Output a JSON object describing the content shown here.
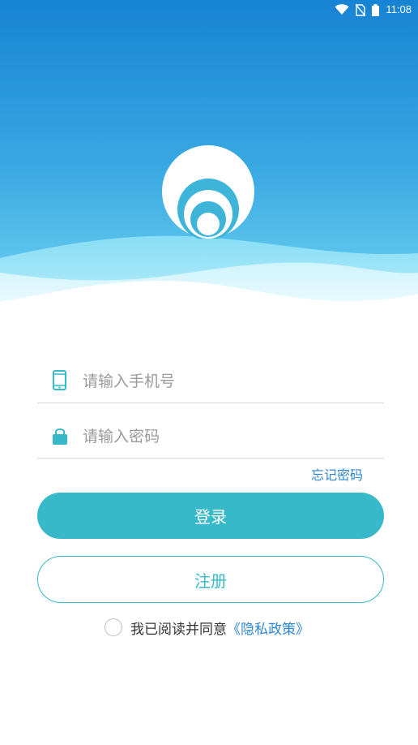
{
  "status_bar": {
    "time": "11:08",
    "icons": [
      "wifi-icon",
      "no-sim-icon",
      "battery-icon"
    ]
  },
  "logo": {
    "icon": "concentric-circles-logo-icon"
  },
  "form": {
    "phone_placeholder": "请输入手机号",
    "phone_icon": "phone-icon",
    "password_placeholder": "请输入密码",
    "password_icon": "lock-icon",
    "forgot_password": "忘记密码",
    "login_label": "登录",
    "register_label": "注册"
  },
  "agreement": {
    "text": "我已阅读并同意",
    "link_text": "《隐私政策》",
    "checked": false
  },
  "colors": {
    "header_top": "#1a86d6",
    "header_bottom": "#56c6ec",
    "wave_light": "#a9e8f8",
    "accent": "#37b9c9",
    "link": "#2e86d1"
  }
}
